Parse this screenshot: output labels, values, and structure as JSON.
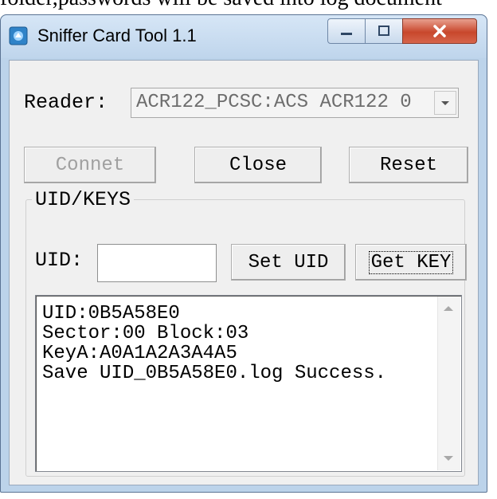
{
  "background_text": "folder,passwords will be saved into log document",
  "window": {
    "title": "Sniffer Card Tool 1.1",
    "controls": {
      "minimize": "—",
      "maximize": "□",
      "close": "✕"
    }
  },
  "reader": {
    "label": "Reader:",
    "selected": "ACR122_PCSC:ACS ACR122 0",
    "dropdown_glyph": "▾"
  },
  "buttons": {
    "connect": "Connet",
    "close": "Close",
    "reset": "Reset",
    "set_uid": "Set UID",
    "get_key": "Get KEY"
  },
  "group": {
    "label": "UID/KEYS",
    "uid_label": "UID:",
    "uid_value": ""
  },
  "log": {
    "lines": [
      "UID:0B5A58E0",
      "Sector:00 Block:03",
      "KeyA:A0A1A2A3A4A5",
      "Save UID_0B5A58E0.log Success."
    ]
  },
  "colors": {
    "title_bar": "#c8dcf0",
    "close_button": "#c8472c",
    "disabled_text": "#a0a0a0"
  }
}
